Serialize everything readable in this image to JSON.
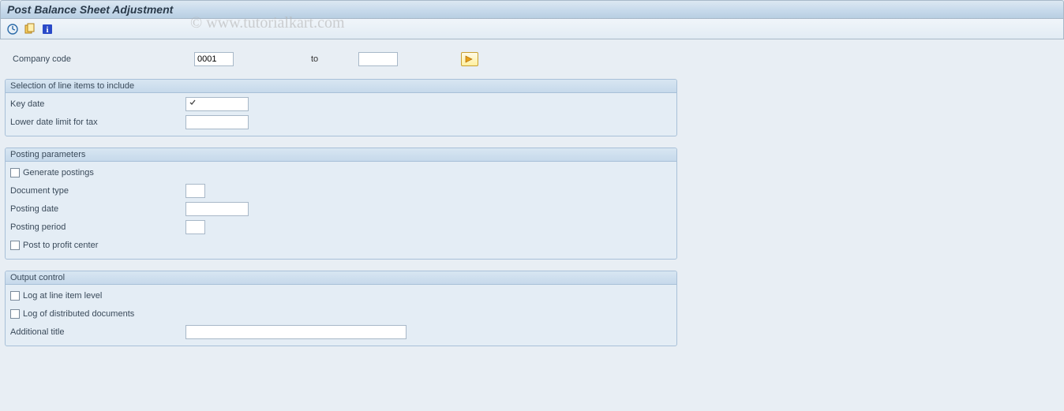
{
  "watermark": "© www.tutorialkart.com",
  "header": {
    "title": "Post Balance Sheet Adjustment"
  },
  "toolbar": {
    "icons": {
      "execute": "execute-icon",
      "variants": "variants-icon",
      "info": "info-icon"
    }
  },
  "selection": {
    "company_code_label": "Company code",
    "company_code_value": "0001",
    "to_label": "to",
    "company_code_to_value": ""
  },
  "group1": {
    "title": "Selection of line items to include",
    "key_date_label": "Key date",
    "key_date_value": "",
    "lower_date_label": "Lower date limit for tax",
    "lower_date_value": ""
  },
  "group2": {
    "title": "Posting parameters",
    "generate_postings_label": "Generate postings",
    "doc_type_label": "Document type",
    "doc_type_value": "",
    "posting_date_label": "Posting date",
    "posting_date_value": "",
    "posting_period_label": "Posting period",
    "posting_period_value": "",
    "post_to_pc_label": "Post to profit center"
  },
  "group3": {
    "title": "Output control",
    "log_line_item_label": "Log at line item level",
    "log_distributed_label": "Log of distributed documents",
    "addl_title_label": "Additional title",
    "addl_title_value": ""
  }
}
